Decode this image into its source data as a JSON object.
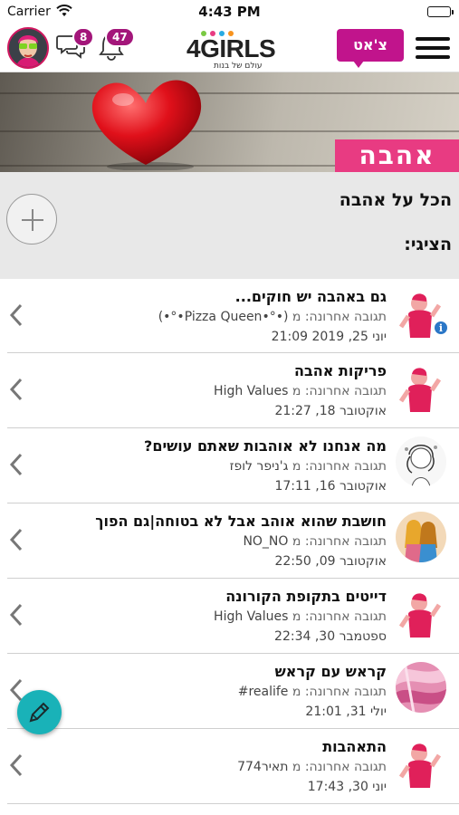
{
  "status_bar": {
    "carrier": "Carrier",
    "time": "4:43 PM"
  },
  "header": {
    "messages_count": "8",
    "notifications_count": "47",
    "logo_text": "4GIRLS",
    "logo_subtitle": "עולם של בנות",
    "chat_label": "צ'אט"
  },
  "hero": {
    "title": "אהבה"
  },
  "section": {
    "title": "הכל על אהבה",
    "filter_label": "הציגי:"
  },
  "threads": [
    {
      "title": "גם באהבה יש חוקים...",
      "last_reply_label": "תגובה אחרונה: מ",
      "last_reply_user": "(•°•Pizza Queen•°•)",
      "date": "יוני 25, 2019 21:09",
      "has_info": true
    },
    {
      "title": "פריקות אהבה",
      "last_reply_label": "תגובה אחרונה: מ",
      "last_reply_user": "High Values",
      "date": "אוקטובר 18, 21:27",
      "has_info": false
    },
    {
      "title": "מה אנחנו לא אוהבות שאתם עושים?",
      "last_reply_label": "תגובה אחרונה: מ",
      "last_reply_user": "ג'ניפר לופז",
      "date": "אוקטובר 16, 17:11",
      "has_info": false
    },
    {
      "title": "חושבת שהוא אוהב אבל לא בטוחה|גם הפוך",
      "last_reply_label": "תגובה אחרונה: מ",
      "last_reply_user": "NO_NO",
      "date": "אוקטובר 09, 22:50",
      "has_info": false
    },
    {
      "title": "דייטים בתקופת הקורונה",
      "last_reply_label": "תגובה אחרונה: מ",
      "last_reply_user": "High Values",
      "date": "ספטמבר 30, 22:34",
      "has_info": false
    },
    {
      "title": "קראש עם קראש",
      "last_reply_label": "תגובה אחרונה: מ",
      "last_reply_user": "realife#",
      "date": "יולי 31, 21:01",
      "has_info": false
    },
    {
      "title": "התאהבות",
      "last_reply_label": "תגובה אחרונה: מ",
      "last_reply_user": "תאיר774",
      "date": "יוני 30, 17:43",
      "has_info": false
    }
  ],
  "colors": {
    "brand_magenta": "#c1148c",
    "hero_pink": "#e83b82",
    "badge_purple": "#a3167a",
    "fab_teal": "#19b2b8"
  },
  "icons": {
    "menu": "hamburger-icon",
    "notifications": "bell-icon",
    "messages": "chat-bubbles-icon",
    "add": "plus-icon",
    "row_chevron": "chevron-left-icon",
    "compose": "pencil-icon"
  }
}
